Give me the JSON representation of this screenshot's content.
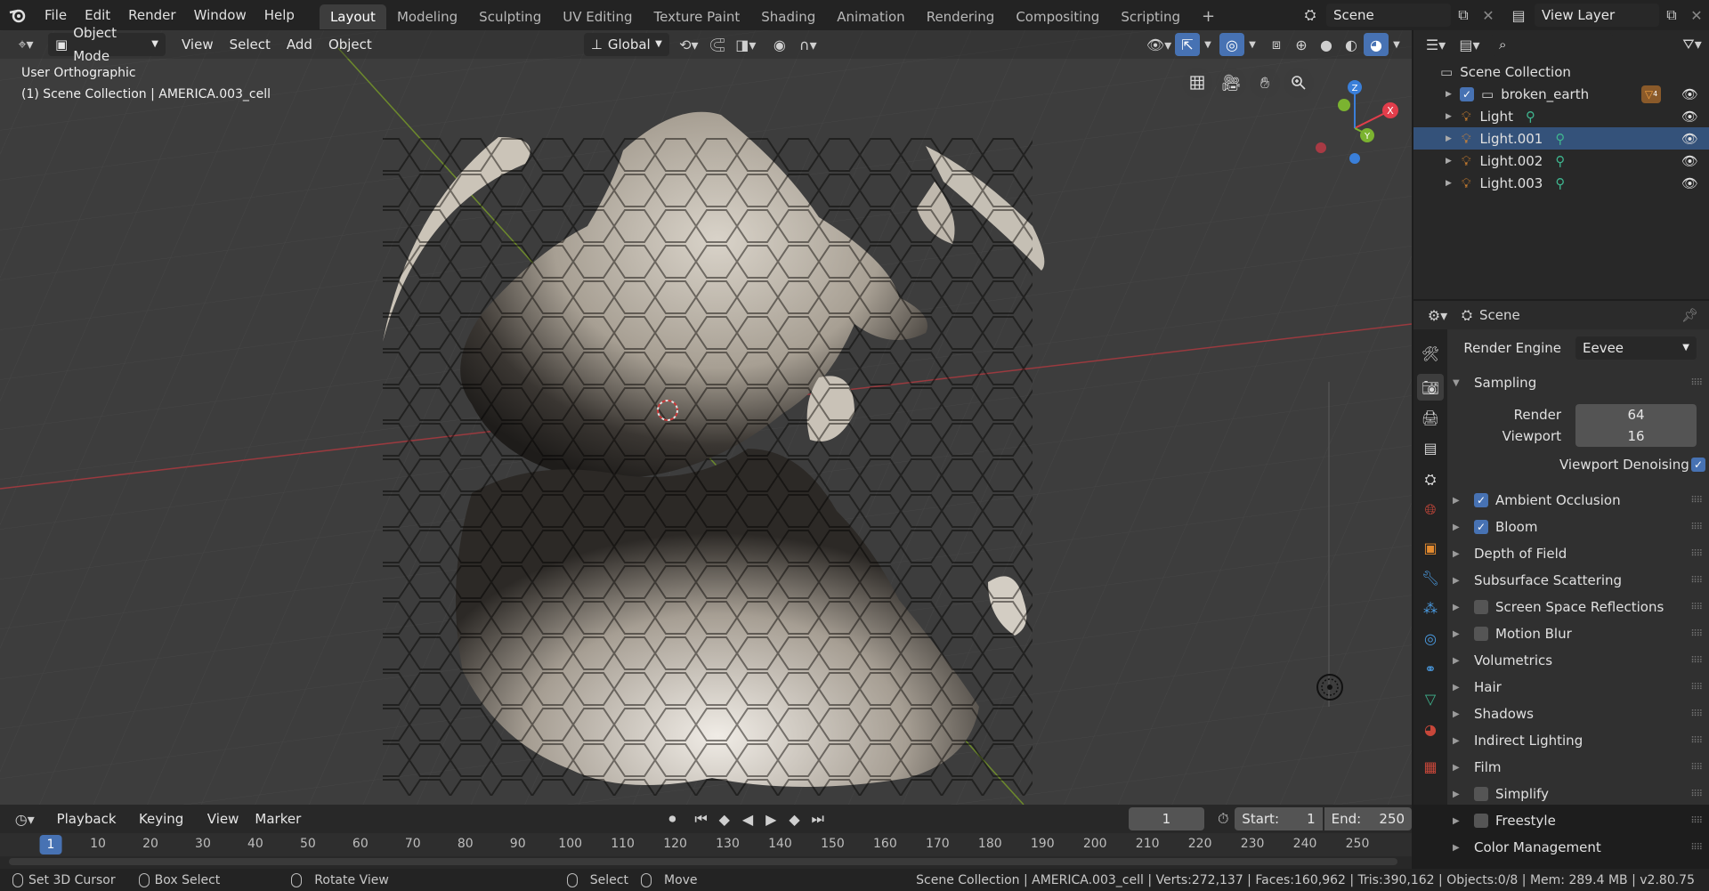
{
  "topbar": {
    "menus": [
      "File",
      "Edit",
      "Render",
      "Window",
      "Help"
    ],
    "workspaces": [
      "Layout",
      "Modeling",
      "Sculpting",
      "UV Editing",
      "Texture Paint",
      "Shading",
      "Animation",
      "Rendering",
      "Compositing",
      "Scripting"
    ],
    "active_workspace": "Layout",
    "add_tab": "+",
    "scene_name": "Scene",
    "view_layer": "View Layer"
  },
  "viewport_header": {
    "mode": "Object Mode",
    "menus": [
      "View",
      "Select",
      "Add",
      "Object"
    ],
    "transform_orientation": "Global"
  },
  "viewport": {
    "view_name": "User Orthographic",
    "collection_info": "(1) Scene Collection | AMERICA.003_cell",
    "gizmo": {
      "x": "X",
      "y": "Y",
      "z": "Z"
    }
  },
  "outliner": {
    "root": "Scene Collection",
    "items": [
      {
        "name": "broken_earth",
        "type": "collection",
        "checked": true,
        "badge": "4"
      },
      {
        "name": "Light",
        "type": "light",
        "selected": false
      },
      {
        "name": "Light.001",
        "type": "light",
        "selected": true
      },
      {
        "name": "Light.002",
        "type": "light",
        "selected": false
      },
      {
        "name": "Light.003",
        "type": "light",
        "selected": false
      }
    ]
  },
  "properties": {
    "context": "Scene",
    "render_engine_label": "Render Engine",
    "render_engine": "Eevee",
    "sampling": {
      "title": "Sampling",
      "render_label": "Render",
      "render_value": "64",
      "viewport_label": "Viewport",
      "viewport_value": "16",
      "denoising_label": "Viewport Denoising",
      "denoising_checked": true
    },
    "panels": [
      {
        "label": "Ambient Occlusion",
        "checkbox": true,
        "checked": true
      },
      {
        "label": "Bloom",
        "checkbox": true,
        "checked": true
      },
      {
        "label": "Depth of Field",
        "checkbox": false
      },
      {
        "label": "Subsurface Scattering",
        "checkbox": false
      },
      {
        "label": "Screen Space Reflections",
        "checkbox": true,
        "checked": false
      },
      {
        "label": "Motion Blur",
        "checkbox": true,
        "checked": false
      },
      {
        "label": "Volumetrics",
        "checkbox": false
      },
      {
        "label": "Hair",
        "checkbox": false
      },
      {
        "label": "Shadows",
        "checkbox": false
      },
      {
        "label": "Indirect Lighting",
        "checkbox": false
      },
      {
        "label": "Film",
        "checkbox": false
      },
      {
        "label": "Simplify",
        "checkbox": true,
        "checked": false
      },
      {
        "label": "Freestyle",
        "checkbox": true,
        "checked": false
      },
      {
        "label": "Color Management",
        "checkbox": false
      }
    ]
  },
  "timeline": {
    "menus": [
      "Playback",
      "Keying",
      "View",
      "Marker"
    ],
    "current_frame": "1",
    "start_label": "Start:",
    "start": "1",
    "end_label": "End:",
    "end": "250",
    "ruler": [
      "1",
      "10",
      "20",
      "30",
      "40",
      "50",
      "60",
      "70",
      "80",
      "90",
      "100",
      "110",
      "120",
      "130",
      "140",
      "150",
      "160",
      "170",
      "180",
      "190",
      "200",
      "210",
      "220",
      "230",
      "240",
      "250"
    ]
  },
  "statusbar": {
    "hints": [
      "Set 3D Cursor",
      "Box Select",
      "Rotate View",
      "Select",
      "Move"
    ],
    "stats": "Scene Collection | AMERICA.003_cell | Verts:272,137 | Faces:160,962 | Tris:390,162 | Objects:0/8 | Mem: 289.4 MB | v2.80.75"
  },
  "colors": {
    "accent": "#4772b3",
    "selected_row": "#34527a",
    "axis_x": "#e23d4b",
    "axis_y": "#7bb330",
    "axis_z": "#3a7fd9",
    "light_icon": "#e28a2f"
  }
}
